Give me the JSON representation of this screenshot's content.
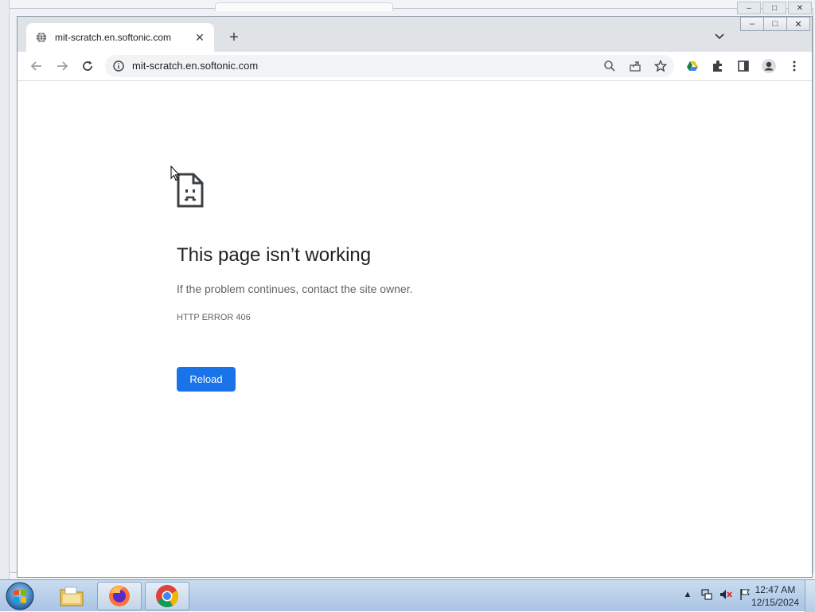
{
  "browser": {
    "tab_title": "mit-scratch.en.softonic.com",
    "new_tab_symbol": "+",
    "tab_close_symbol": "✕",
    "url": "mit-scratch.en.softonic.com",
    "window_controls": [
      "–",
      "□",
      "✕"
    ]
  },
  "error_page": {
    "title": "This page isn’t working",
    "message": "If the problem continues, contact the site owner.",
    "code": "HTTP ERROR 406",
    "reload_label": "Reload"
  },
  "taskbar": {
    "apps": [
      "file-explorer-icon",
      "firefox-icon",
      "chrome-icon"
    ],
    "time": "12:47 AM",
    "date": "12/15/2024"
  },
  "colors": {
    "accent": "#1a73e8",
    "title_text": "#202124",
    "secondary_text": "#5f6368"
  }
}
